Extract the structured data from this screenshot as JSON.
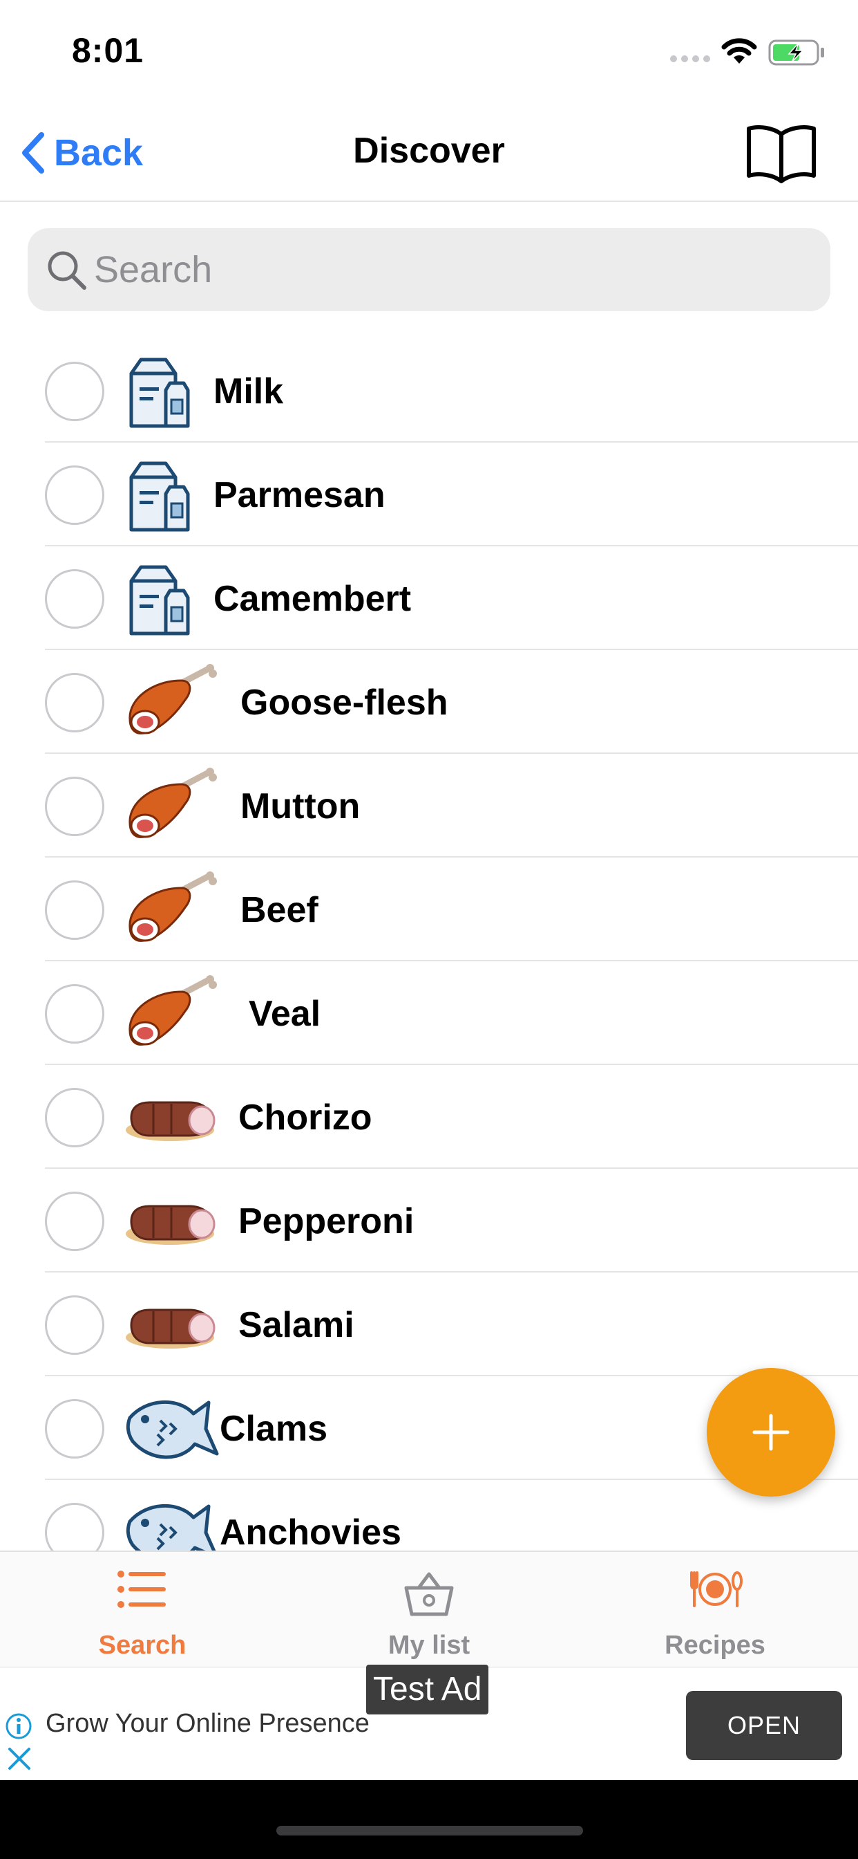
{
  "status_bar": {
    "time": "8:01"
  },
  "nav": {
    "back_label": "Back",
    "title": "Discover"
  },
  "search": {
    "placeholder": "Search",
    "value": ""
  },
  "items": [
    {
      "label": "Milk",
      "icon": "milk-carton-icon"
    },
    {
      "label": "Parmesan",
      "icon": "milk-carton-icon"
    },
    {
      "label": "Camembert",
      "icon": "milk-carton-icon"
    },
    {
      "label": "Goose-flesh",
      "icon": "ham-leg-icon"
    },
    {
      "label": "Mutton",
      "icon": "ham-leg-icon"
    },
    {
      "label": "Beef",
      "icon": "ham-leg-icon"
    },
    {
      "label": "Veal",
      "icon": "ham-leg-icon"
    },
    {
      "label": "Chorizo",
      "icon": "sausage-icon"
    },
    {
      "label": "Pepperoni",
      "icon": "sausage-icon"
    },
    {
      "label": "Salami",
      "icon": "sausage-icon"
    },
    {
      "label": "Clams",
      "icon": "fish-icon"
    },
    {
      "label": "Anchovies",
      "icon": "fish-icon"
    }
  ],
  "tabs": [
    {
      "label": "Search",
      "icon": "list-icon",
      "active": true
    },
    {
      "label": "My list",
      "icon": "basket-icon",
      "active": false
    },
    {
      "label": "Recipes",
      "icon": "plate-cutlery-icon",
      "active": false
    }
  ],
  "ad": {
    "tag": "Test Ad",
    "headline": "Grow Your Online Presence",
    "button": "OPEN"
  },
  "colors": {
    "accent_blue": "#2e7cf6",
    "active_tab": "#f07b3f",
    "inactive_tab": "#8e8e93",
    "fab": "#f39c12",
    "battery_green": "#4cd964"
  }
}
